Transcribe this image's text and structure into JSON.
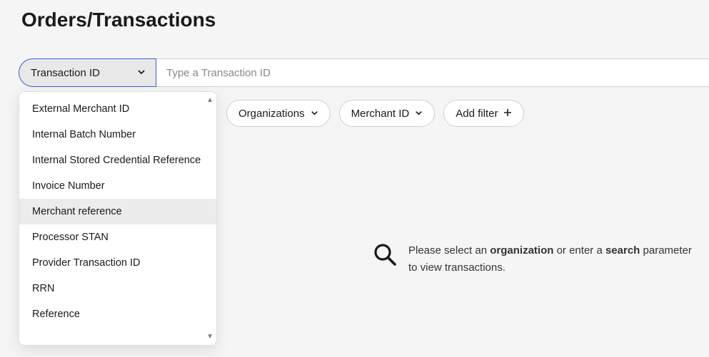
{
  "page_title": "Orders/Transactions",
  "search": {
    "selected_filter": "Transaction ID",
    "placeholder": "Type a Transaction ID",
    "value": ""
  },
  "dropdown": {
    "options": [
      "External Merchant ID",
      "Internal Batch Number",
      "Internal Stored Credential Reference",
      "Invoice Number",
      "Merchant reference",
      "Processor STAN",
      "Provider Transaction ID",
      "RRN",
      "Reference"
    ],
    "hovered_index": 4
  },
  "filters": {
    "organizations_label": "Organizations",
    "merchant_id_label": "Merchant ID",
    "add_filter_label": "Add filter"
  },
  "empty_state": {
    "prefix": "Please select an ",
    "bold1": "organization",
    "mid": " or enter a ",
    "bold2": "search",
    "suffix": " parameter to view transactions."
  }
}
